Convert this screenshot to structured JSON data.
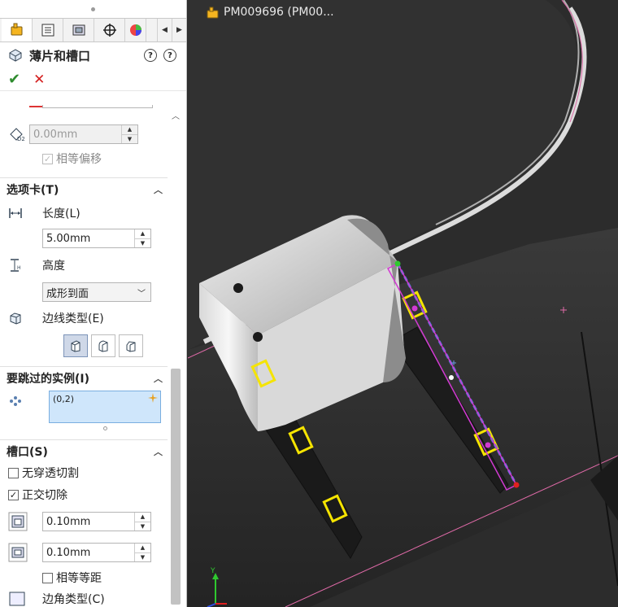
{
  "panel": {
    "feature_title": "薄片和槽口",
    "ok_label": "✔",
    "cancel_label": "✕",
    "offset": {
      "d2_value": "0.00mm",
      "equal_offset_label": "相等偏移"
    },
    "tabs_section": {
      "header": "选项卡(T)",
      "length_label": "长度(L)",
      "length_value": "5.00mm",
      "height_label": "高度",
      "height_value": "成形到面",
      "edge_type_label": "边线类型(E)"
    },
    "skip_section": {
      "header": "要跳过的实例(I)",
      "instances": [
        "(0,2)"
      ]
    },
    "slot_section": {
      "header": "槽口(S)",
      "no_through_cut_label": "无穿透切割",
      "normal_cut_label": "正交切除",
      "normal_cut_checked": true,
      "no_through_cut_checked": false,
      "gap1_value": "0.10mm",
      "gap2_value": "0.10mm",
      "equal_gap_label": "相等等距",
      "corner_type_label": "边角类型(C)"
    }
  },
  "viewport": {
    "part_name": "PM009696 (PM00..."
  },
  "colors": {
    "accent_yellow": "#f5e400",
    "selection_blue": "#4a7fd8",
    "magenta": "#d23ad2"
  }
}
